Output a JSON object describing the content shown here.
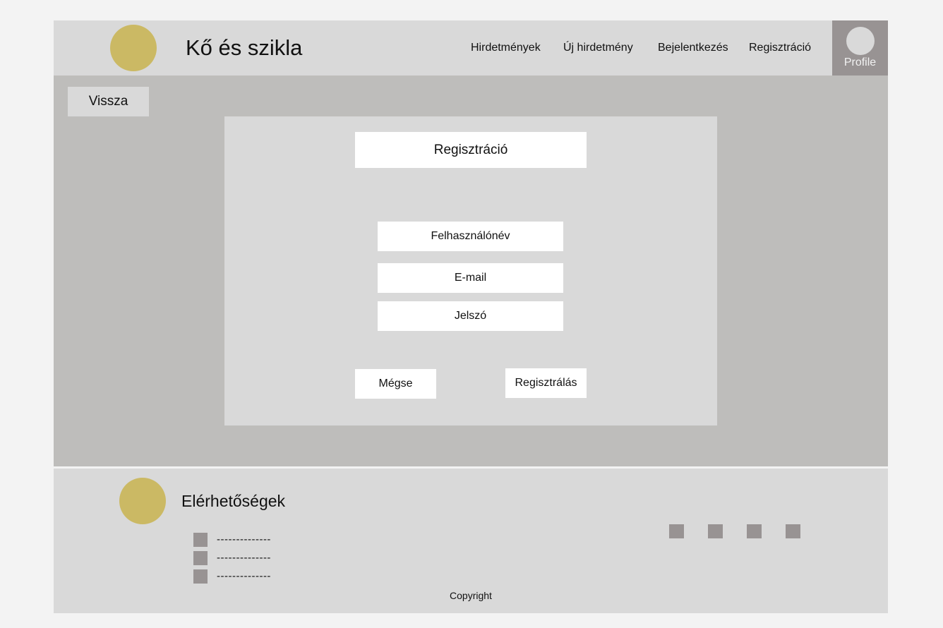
{
  "header": {
    "title": "Kő és szikla",
    "nav": [
      "Hirdetmények",
      "Új hirdetmény",
      "Bejelentkezés",
      "Regisztráció"
    ],
    "profile_label": "Profile"
  },
  "main": {
    "back_label": "Vissza",
    "form": {
      "title": "Regisztráció",
      "username_placeholder": "Felhasználónév",
      "email_placeholder": "E-mail",
      "password_placeholder": "Jelszó",
      "cancel_label": "Mégse",
      "submit_label": "Regisztrálás"
    }
  },
  "footer": {
    "contacts_title": "Elérhetőségek",
    "contacts": [
      "--------------",
      "--------------",
      "--------------"
    ],
    "social_icons": [
      "social-icon",
      "social-icon",
      "social-icon",
      "social-icon"
    ],
    "copyright": "Copyright"
  },
  "colors": {
    "page_bg": "#f3f3f3",
    "header_bg": "#d9d9d9",
    "main_bg": "#bebdbb",
    "logo": "#cbb964",
    "icon_gray": "#989393",
    "card_white": "#ffffff"
  }
}
